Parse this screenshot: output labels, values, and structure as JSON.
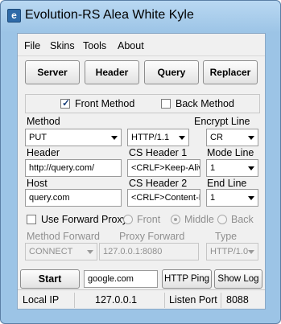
{
  "window": {
    "title": "Evolution-RS Alea White Kyle",
    "icon_letter": "e"
  },
  "menu": [
    "File",
    "Skins",
    "Tools",
    "About"
  ],
  "tabs": [
    "Server",
    "Header",
    "Query",
    "Replacer"
  ],
  "method_options": {
    "front_label": "Front Method",
    "front_checked": true,
    "back_label": "Back Method",
    "back_checked": false
  },
  "labels": {
    "method": "Method",
    "encrypt_line": "Encrypt Line",
    "header": "Header",
    "cs_header_1": "CS Header 1",
    "mode_line": "Mode Line",
    "host": "Host",
    "cs_header_2": "CS Header 2",
    "end_line": "End Line",
    "method_forward": "Method Forward",
    "proxy_forward": "Proxy Forward",
    "type": "Type"
  },
  "fields": {
    "method": "PUT",
    "http_version": "HTTP/1.1",
    "encrypt_line": "CR",
    "header": "http://query.com/",
    "cs_header_1": "<CRLF>Keep-Alive",
    "mode_line": "1",
    "host": "query.com",
    "cs_header_2": "<CRLF>Content-Le",
    "end_line": "1",
    "method_forward": "CONNECT",
    "proxy_forward": "127.0.0.1:8080",
    "type": "HTTP/1.0",
    "target_host": "google.com"
  },
  "proxy": {
    "use_label": "Use Forward Proxy",
    "use_checked": false,
    "radios": [
      {
        "label": "Front",
        "selected": false
      },
      {
        "label": "Middle",
        "selected": true
      },
      {
        "label": "Back",
        "selected": false
      }
    ]
  },
  "buttons": {
    "start": "Start",
    "http_ping": "HTTP Ping",
    "show_log": "Show Log"
  },
  "status": {
    "local_ip_label": "Local IP",
    "local_ip": "127.0.0.1",
    "listen_port_label": "Listen Port",
    "listen_port": "8088"
  }
}
